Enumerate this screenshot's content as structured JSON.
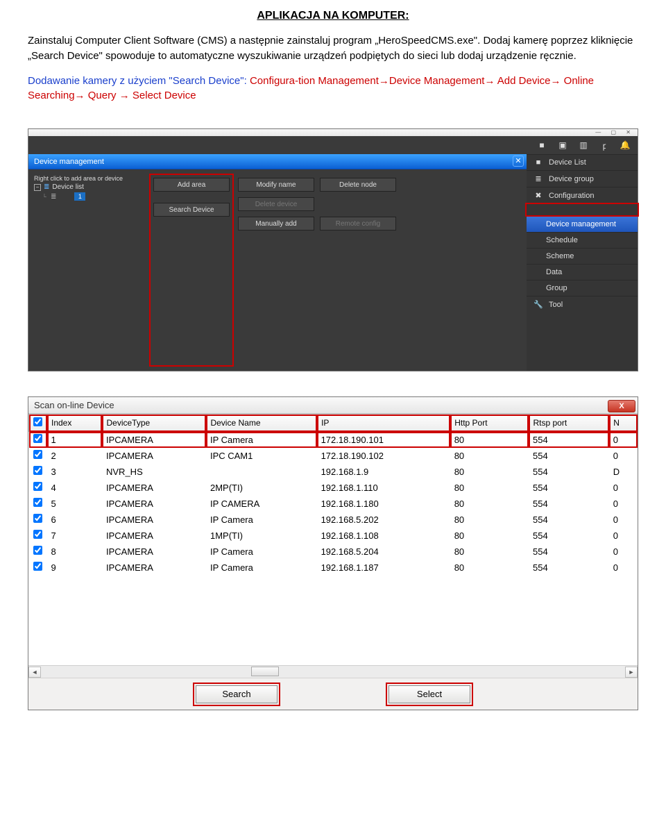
{
  "doc": {
    "title": "APLIKACJA NA KOMPUTER:",
    "p1": "Zainstaluj Computer Client Software (CMS) a następnie zainstaluj program „HeroSpeedCMS.exe\". Dodaj kamerę poprzez kliknięcie „Search Device\" spowoduje to automatyczne wyszukiwanie urządzeń podpiętych do sieci lub dodaj urządzenie ręcznie.",
    "p2a": "Dodawanie kamery z użyciem \"Search Device\": ",
    "p2b": "Configura-tion Management→Device Management→ Add Device→ Online Searching→ Query → Select Device"
  },
  "app": {
    "panel_title": "Device management",
    "tree_hint": "Right click to add area or device",
    "tree_root": "Device list",
    "tree_child": "1",
    "buttons": {
      "add_area": "Add area",
      "search_device": "Search Device",
      "modify_name": "Modify name",
      "delete_device": "Delete device",
      "manually_add": "Manually add",
      "delete_node": "Delete node",
      "remote_config": "Remote config"
    },
    "nav": {
      "device_list": "Device List",
      "device_group": "Device group",
      "configuration": "Configuration",
      "device_mgmt": "Device management",
      "schedule": "Schedule",
      "scheme": "Scheme",
      "data": "Data",
      "group": "Group",
      "tool": "Tool"
    }
  },
  "scan": {
    "title": "Scan on-line Device",
    "headers": {
      "index": "Index",
      "type": "DeviceType",
      "name": "Device Name",
      "ip": "IP",
      "http": "Http Port",
      "rtsp": "Rtsp port",
      "n": "N"
    },
    "rows": [
      {
        "idx": "1",
        "type": "IPCAMERA",
        "name": "IP Camera",
        "ip": "172.18.190.101",
        "http": "80",
        "rtsp": "554",
        "n": "0"
      },
      {
        "idx": "2",
        "type": "IPCAMERA",
        "name": "IPC CAM1",
        "ip": "172.18.190.102",
        "http": "80",
        "rtsp": "554",
        "n": "0"
      },
      {
        "idx": "3",
        "type": "NVR_HS",
        "name": "",
        "ip": "192.168.1.9",
        "http": "80",
        "rtsp": "554",
        "n": "D"
      },
      {
        "idx": "4",
        "type": "IPCAMERA",
        "name": "2MP(TI)",
        "ip": "192.168.1.110",
        "http": "80",
        "rtsp": "554",
        "n": "0"
      },
      {
        "idx": "5",
        "type": "IPCAMERA",
        "name": "IP CAMERA",
        "ip": "192.168.1.180",
        "http": "80",
        "rtsp": "554",
        "n": "0"
      },
      {
        "idx": "6",
        "type": "IPCAMERA",
        "name": "IP Camera",
        "ip": "192.168.5.202",
        "http": "80",
        "rtsp": "554",
        "n": "0"
      },
      {
        "idx": "7",
        "type": "IPCAMERA",
        "name": "1MP(TI)",
        "ip": "192.168.1.108",
        "http": "80",
        "rtsp": "554",
        "n": "0"
      },
      {
        "idx": "8",
        "type": "IPCAMERA",
        "name": "IP Camera",
        "ip": "192.168.5.204",
        "http": "80",
        "rtsp": "554",
        "n": "0"
      },
      {
        "idx": "9",
        "type": "IPCAMERA",
        "name": "IP Camera",
        "ip": "192.168.1.187",
        "http": "80",
        "rtsp": "554",
        "n": "0"
      }
    ],
    "footer": {
      "search": "Search",
      "select": "Select"
    }
  }
}
